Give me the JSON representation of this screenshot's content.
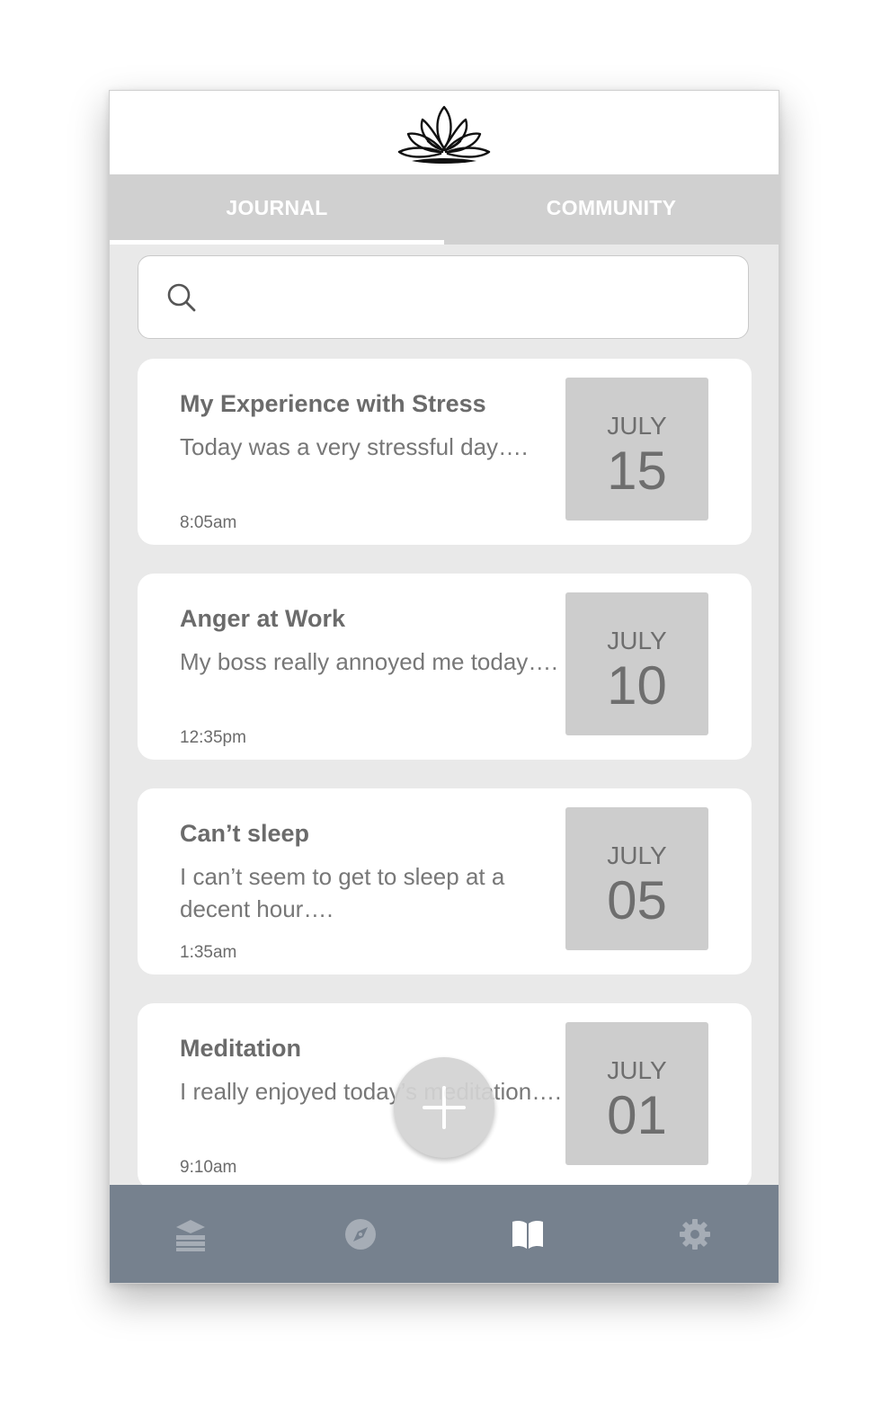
{
  "app": {
    "logo_icon": "lotus-icon"
  },
  "tabs": [
    {
      "label": "JOURNAL",
      "active": true
    },
    {
      "label": "COMMUNITY",
      "active": false
    }
  ],
  "search": {
    "placeholder": "",
    "value": "",
    "icon": "search-icon"
  },
  "entries": [
    {
      "title": "My Experience with Stress",
      "preview": "Today was a very stressful day….",
      "time": "8:05am",
      "month": "JULY",
      "day": "15"
    },
    {
      "title": "Anger at Work",
      "preview": "My boss really annoyed me today….",
      "time": "12:35pm",
      "month": "JULY",
      "day": "10"
    },
    {
      "title": "Can’t sleep",
      "preview": "I can’t seem to get to sleep at a decent hour….",
      "time": "1:35am",
      "month": "JULY",
      "day": "05"
    },
    {
      "title": "Meditation",
      "preview": "I really enjoyed today’s meditation….",
      "time": "9:10am",
      "month": "JULY",
      "day": "01"
    }
  ],
  "fab": {
    "icon": "plus-icon"
  },
  "bottom_nav": [
    {
      "icon": "layers-icon",
      "active": false
    },
    {
      "icon": "compass-icon",
      "active": false
    },
    {
      "icon": "book-icon",
      "active": true
    },
    {
      "icon": "gear-icon",
      "active": false
    }
  ],
  "colors": {
    "tab_bar": "#d0d0d0",
    "background": "#e9e9e9",
    "date_box": "#cdcdcd",
    "bottom_nav": "#76818e",
    "nav_icon_inactive": "#a6adb6",
    "nav_icon_active": "#ffffff"
  }
}
